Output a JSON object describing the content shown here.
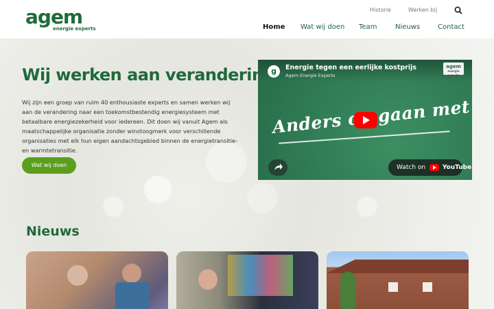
{
  "header": {
    "logo_word": "agem",
    "logo_sub": "energie experts",
    "top_links": [
      "Historie",
      "Werken bij"
    ],
    "nav": [
      "Home",
      "Wat wij doen",
      "Team",
      "Nieuws",
      "Contact"
    ],
    "active_nav": "Home"
  },
  "hero": {
    "title": "Wij werken aan verandering",
    "text": "Wij zijn een groep van ruim 40 enthousiaste experts en samen werken wij aan de verandering naar een toekomstbestendig energiesysteem met betaalbare energiezekerheid voor iedereen. Dit doen wij vanuit Agem als maatschappelijke organisatie zonder winstoogmerk voor verschillende organisaties met elk hun eigen aandachtsgebied binnen de energietransitie- en warmtetransitie.",
    "button": "Wat wij doen"
  },
  "video": {
    "avatar_letter": "g",
    "title": "Energie tegen een eerlijke kostprijs",
    "channel": "Agem Energie Experts",
    "corner_logo": "agem",
    "corner_logo_sub": "energie experts",
    "handwriting": "Anders omgaan met energie!",
    "watch_label": "Watch on",
    "youtube_label": "YouTube"
  },
  "news": {
    "title": "Nieuws"
  },
  "colors": {
    "brand_green": "#1e6a3c",
    "button_green": "#5c9e1e",
    "youtube_red": "#ff0000"
  },
  "icons": {
    "search": "search-icon",
    "share": "share-icon",
    "play": "play-icon"
  }
}
